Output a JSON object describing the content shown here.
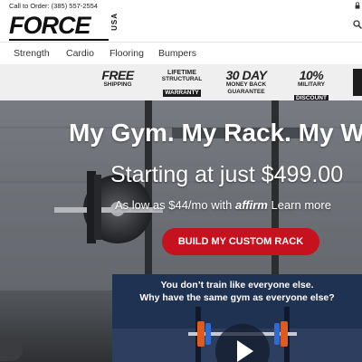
{
  "header": {
    "call_text": "Call to Order: (385) 557-2554",
    "logo_main": "FORCE",
    "logo_sub": "USA"
  },
  "nav": {
    "items": [
      {
        "label": "Strength"
      },
      {
        "label": "Cardio"
      },
      {
        "label": "Flooring"
      },
      {
        "label": "Bumpers"
      }
    ]
  },
  "badges": [
    {
      "big": "FREE",
      "small": "SHIPPING"
    },
    {
      "big": "LIFETIME",
      "line2": "STRUCTURAL",
      "box": "WARRANTY"
    },
    {
      "big": "30 DAY",
      "small": "MONEY BACK",
      "line3": "GUARANTEE"
    },
    {
      "big": "10%",
      "small": "MILITARY",
      "box": "DISCOUNT"
    }
  ],
  "hero": {
    "title": "My Gym. My Rack. My W",
    "price_line": "Starting at just $499.00",
    "finance_prefix": "As low as $44/mo with",
    "finance_brand": "affirm",
    "finance_suffix": "Learn more",
    "cta_label": "BUILD MY CUSTOM RACK"
  },
  "video": {
    "line1": "You don’t train like everyone else.",
    "line2": "Why have the same gym as everyone else?"
  },
  "colors": {
    "accent_red": "#c5121e",
    "video_bg": "#1f3150",
    "badge_bg": "#efefef"
  },
  "icons": [
    "lock-icon",
    "search-icon",
    "play-icon"
  ]
}
